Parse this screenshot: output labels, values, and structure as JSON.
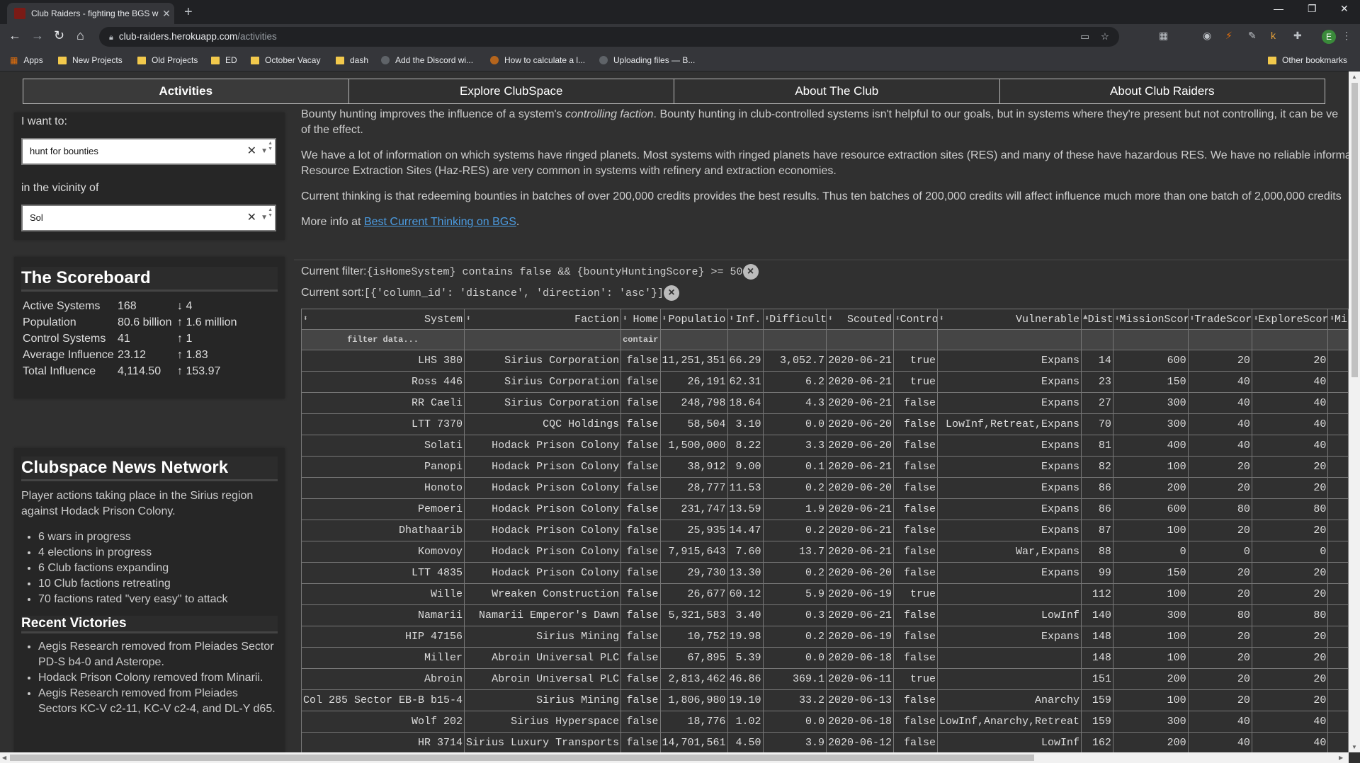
{
  "browser": {
    "tab_title": "Club Raiders - fighting the BGS w",
    "url_host": "club-raiders.herokuapp.com",
    "url_path": "/activities",
    "bookmarks": [
      "Apps",
      "New Projects",
      "Old Projects",
      "ED",
      "October Vacay",
      "dash",
      "Add the Discord wi...",
      "How to calculate a l...",
      "Uploading files — B..."
    ],
    "other_bookmarks": "Other bookmarks",
    "profile_initial": "E"
  },
  "nav": {
    "tabs": [
      "Activities",
      "Explore ClubSpace",
      "About The Club",
      "About Club Raiders"
    ]
  },
  "controls": {
    "want_label": "I want to:",
    "activity_value": "hunt for bounties",
    "vicinity_label": "in the vicinity of",
    "origin_value": "Sol"
  },
  "scoreboard": {
    "title": "The Scoreboard",
    "rows": [
      {
        "label": "Active Systems",
        "value": "168",
        "change": "↓ 4"
      },
      {
        "label": "Population",
        "value": "80.6 billion",
        "change": "↑ 1.6 million"
      },
      {
        "label": "Control Systems",
        "value": "41",
        "change": "↑ 1"
      },
      {
        "label": "Average Influence",
        "value": "23.12",
        "change": "↑ 1.83"
      },
      {
        "label": "Total Influence",
        "value": "4,114.50",
        "change": "↑ 153.97"
      }
    ]
  },
  "news": {
    "title": "Clubspace News Network",
    "intro": "Player actions taking place in the Sirius region against Hodack Prison Colony.",
    "items": [
      "6 wars in progress",
      "4 elections in progress",
      "6 Club factions expanding",
      "10 Club factions retreating",
      "70 factions rated \"very easy\" to attack"
    ],
    "victories_title": "Recent Victories",
    "victories": [
      "Aegis Research removed from Pleiades Sector PD-S b4-0 and Asterope.",
      "Hodack Prison Colony removed from Minarii.",
      "Aegis Research removed from Pleiades Sectors KC-V c2-11, KC-V c2-4, and DL-Y d65."
    ]
  },
  "intro": {
    "p1_before": "Bounty hunting improves the influence of a system's ",
    "p1_em": "controlling faction",
    "p1_after": ". Bounty hunting in club-controlled systems isn't helpful to our goals, but in systems where they're present but not controlling, it can be ve",
    "p1_line2": "of the effect.",
    "p2_line1": "We have a lot of information on which systems have ringed planets. Most systems with ringed planets have resource extraction sites (RES) and many of these have hazardous RES. We have no reliable informat",
    "p2_line2": "Resource Extraction Sites (Haz-RES) are very common in systems with refinery and extraction economies.",
    "p3": "Current thinking is that redeeming bounties in batches of over 200,000 credits provides the best results. Thus ten batches of 200,000 credits will affect influence much more than one batch of 2,000,000 credits",
    "more_prefix": "More info at ",
    "more_link": "Best Current Thinking on BGS",
    "more_suffix": "."
  },
  "filter": {
    "filter_label": "Current filter:",
    "filter_value": "{isHomeSystem} contains false && {bountyHuntingScore} >= 50",
    "sort_label": "Current sort:",
    "sort_value": "[{'column_id': 'distance', 'direction': 'asc'}]"
  },
  "table": {
    "columns": [
      "System",
      "Faction",
      "Home",
      "Populatio",
      "Inf.",
      "Difficult",
      "Scouted",
      "Contro",
      "Vulnerable",
      "Dist",
      "MissionScor",
      "TradeScor",
      "ExploreScor",
      "Mi"
    ],
    "filter_placeholder": "filter data...",
    "home_filter": "contair",
    "rows": [
      [
        "LHS 380",
        "Sirius Corporation",
        "false",
        "11,251,351",
        "66.29",
        "3,052.7",
        "2020-06-21",
        "true",
        "Expans",
        "14",
        "600",
        "20",
        "20"
      ],
      [
        "Ross 446",
        "Sirius Corporation",
        "false",
        "26,191",
        "62.31",
        "6.2",
        "2020-06-21",
        "true",
        "Expans",
        "23",
        "150",
        "40",
        "40"
      ],
      [
        "RR Caeli",
        "Sirius Corporation",
        "false",
        "248,798",
        "18.64",
        "4.3",
        "2020-06-21",
        "false",
        "Expans",
        "27",
        "300",
        "40",
        "40"
      ],
      [
        "LTT 7370",
        "CQC Holdings",
        "false",
        "58,504",
        "3.10",
        "0.0",
        "2020-06-20",
        "false",
        "LowInf,Retreat,Expans",
        "70",
        "300",
        "40",
        "40"
      ],
      [
        "Solati",
        "Hodack Prison Colony",
        "false",
        "1,500,000",
        "8.22",
        "3.3",
        "2020-06-20",
        "false",
        "Expans",
        "81",
        "400",
        "40",
        "40"
      ],
      [
        "Panopi",
        "Hodack Prison Colony",
        "false",
        "38,912",
        "9.00",
        "0.1",
        "2020-06-21",
        "false",
        "Expans",
        "82",
        "100",
        "20",
        "20"
      ],
      [
        "Honoto",
        "Hodack Prison Colony",
        "false",
        "28,777",
        "11.53",
        "0.2",
        "2020-06-20",
        "false",
        "Expans",
        "86",
        "200",
        "20",
        "20"
      ],
      [
        "Pemoeri",
        "Hodack Prison Colony",
        "false",
        "231,747",
        "13.59",
        "1.9",
        "2020-06-21",
        "false",
        "Expans",
        "86",
        "600",
        "80",
        "80"
      ],
      [
        "Dhathaarib",
        "Hodack Prison Colony",
        "false",
        "25,935",
        "14.47",
        "0.2",
        "2020-06-21",
        "false",
        "Expans",
        "87",
        "100",
        "20",
        "20"
      ],
      [
        "Komovoy",
        "Hodack Prison Colony",
        "false",
        "7,915,643",
        "7.60",
        "13.7",
        "2020-06-21",
        "false",
        "War,Expans",
        "88",
        "0",
        "0",
        "0"
      ],
      [
        "LTT 4835",
        "Hodack Prison Colony",
        "false",
        "29,730",
        "13.30",
        "0.2",
        "2020-06-20",
        "false",
        "Expans",
        "99",
        "150",
        "20",
        "20"
      ],
      [
        "Wille",
        "Wreaken Construction",
        "false",
        "26,677",
        "60.12",
        "5.9",
        "2020-06-19",
        "true",
        "",
        "112",
        "100",
        "20",
        "20"
      ],
      [
        "Namarii",
        "Namarii Emperor's Dawn",
        "false",
        "5,321,583",
        "3.40",
        "0.3",
        "2020-06-21",
        "false",
        "LowInf",
        "140",
        "300",
        "80",
        "80"
      ],
      [
        "HIP 47156",
        "Sirius Mining",
        "false",
        "10,752",
        "19.98",
        "0.2",
        "2020-06-19",
        "false",
        "Expans",
        "148",
        "100",
        "20",
        "20"
      ],
      [
        "Miller",
        "Abroin Universal PLC",
        "false",
        "67,895",
        "5.39",
        "0.0",
        "2020-06-18",
        "false",
        "",
        "148",
        "100",
        "20",
        "20"
      ],
      [
        "Abroin",
        "Abroin Universal PLC",
        "false",
        "2,813,462",
        "46.86",
        "369.1",
        "2020-06-11",
        "true",
        "",
        "151",
        "200",
        "20",
        "20"
      ],
      [
        "Col 285 Sector EB-B b15-4",
        "Sirius Mining",
        "false",
        "1,806,980",
        "19.10",
        "33.2",
        "2020-06-13",
        "false",
        "Anarchy",
        "159",
        "100",
        "20",
        "20"
      ],
      [
        "Wolf 202",
        "Sirius Hyperspace",
        "false",
        "18,776",
        "1.02",
        "0.0",
        "2020-06-18",
        "false",
        "LowInf,Anarchy,Retreat",
        "159",
        "300",
        "40",
        "40"
      ],
      [
        "HR 3714",
        "Sirius Luxury Transports",
        "false",
        "14,701,561",
        "4.50",
        "3.9",
        "2020-06-12",
        "false",
        "LowInf",
        "162",
        "200",
        "40",
        "40"
      ]
    ]
  }
}
